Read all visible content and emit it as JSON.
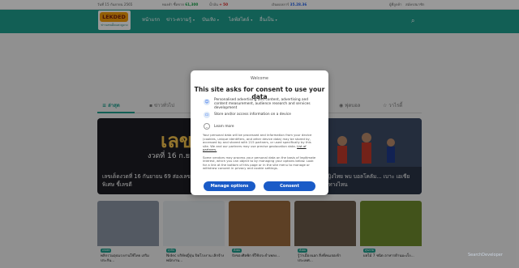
{
  "topbar": {
    "date": "วันที่ 15 กันยายน 2565",
    "gold_label": "ทองคำ ซื้อขาย",
    "gold_value": "61,300",
    "gold_change": "+ 50",
    "oil_label": "น้ำมัน",
    "oil_change": "+ 50",
    "exchange_label": "เงินดอลลาร์",
    "exchange_value": "35.28.36",
    "links": [
      "ผู้ที่ลูกค้า",
      "สมัครสมาชิก"
    ]
  },
  "header": {
    "logo_text": "LEKDED",
    "logo_sub": "ข่าวเลขเด็ดและดูดวง",
    "nav": [
      {
        "label": "หน้าแรก",
        "has_menu": false
      },
      {
        "label": "ข่าว-ความรู้",
        "has_menu": true
      },
      {
        "label": "บันเทิง",
        "has_menu": true
      },
      {
        "label": "ไลฟ์สไตล์",
        "has_menu": true
      },
      {
        "label": "อื่นเป็น",
        "has_menu": true
      }
    ],
    "search_icon": "search-icon"
  },
  "tabs": [
    {
      "label": "ล่าสุด",
      "active": true,
      "icon": "list-icon"
    },
    {
      "label": "ข่าวทั่วไป",
      "active": false,
      "icon": "news-icon"
    },
    {
      "label": "ฟุตบอล",
      "active": false,
      "icon": "football-icon"
    },
    {
      "label": "วาไรตี้",
      "active": false,
      "icon": "star-icon"
    }
  ],
  "hero": [
    {
      "art_title": "เลขเด็ด",
      "art_sub": "งวดที่ 16 ก.ย. 69",
      "caption": "เลขเด็ดงวดที่ 16 กันยายน 69 ส่องเลขเด็ด คัดงวด ทุกพิเศษ ชี้เลขดี"
    },
    {
      "caption": "...วอลเลย์บอลหญิงไทย พบ บอลโคลัม... เบาะ เอเชียเกมส์ 2026 ช่องทางไหน"
    }
  ],
  "cards": [
    {
      "tag": "เกษตร",
      "title": "พลิกรวมอุปแรงงานใช้ไทย เสริม ประกัน..."
    },
    {
      "tag": "ธุรกิจ",
      "title": "Nidec บริษัทญี่ปุ่น ปิดโรงงาน เลิกจ้างพนักงาน..."
    },
    {
      "tag": "สังคม",
      "title": "ปังของศิลพิก ที่ใช้ประจำเพลง..."
    },
    {
      "tag": "สังคม",
      "title": "รู้ว่าเมืองนอก สิ่งที่คนเจอเข้าประเทศ..."
    },
    {
      "tag": "สุขภาพ",
      "title": "ผลไม้ 7 ชนิด อาหารต้านมะเร็ง..."
    }
  ],
  "consent": {
    "welcome": "Welcome",
    "title": "This site asks for consent to use your data",
    "purpose1": "Personalised advertising and content, advertising and content measurement, audience research and services development",
    "purpose2": "Store and/or access information on a device",
    "learn_more": "Learn more",
    "body_a": "Your personal data will be processed and information from your device (cookies, unique identifiers, and other device data) may be stored by, accessed by and shared with 215 partners, or used specifically by this site. We and our partners may use precise geolocation data.",
    "list_link": "List of partners.",
    "body_b": "Some vendors may process your personal data on the basis of legitimate interest, which you can object to by managing your options below. Look for a link at the bottom of this page or in the site menu to manage or withdraw consent in privacy and cookie settings.",
    "manage_label": "Manage options",
    "consent_label": "Consent"
  },
  "watermark": "SearchDeveloper"
}
